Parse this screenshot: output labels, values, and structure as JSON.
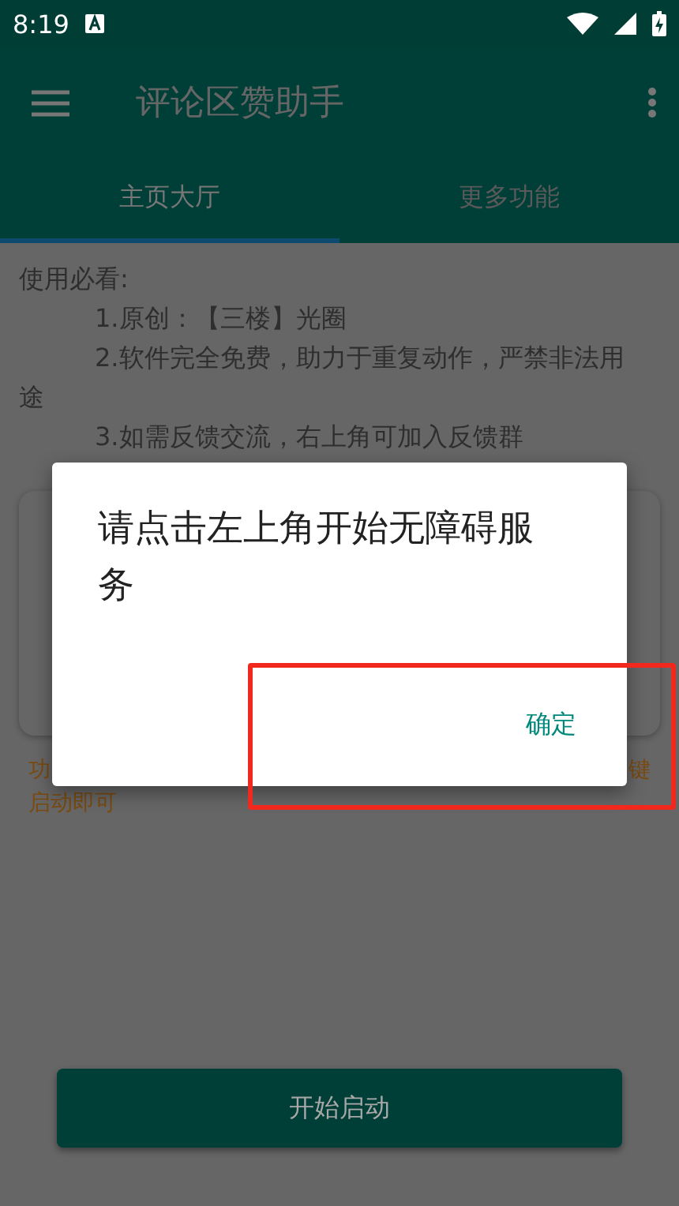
{
  "status_bar": {
    "time": "8:19"
  },
  "app_bar": {
    "title": "评论区赞助手"
  },
  "tabs": [
    {
      "label": "主页大厅",
      "selected": true
    },
    {
      "label": "更多功能",
      "selected": false
    }
  ],
  "notice": {
    "heading": "使用必看:",
    "items": [
      "1.原创：【三楼】光圈",
      "2.软件完全免费，助力于重复动作，严禁非法用途",
      "3.如需反馈交流，右上角可加入反馈群"
    ]
  },
  "hint": {
    "line_1_start": "功",
    "line_1_end": "键",
    "line_2": "启动即可"
  },
  "start_button": {
    "label": "开始启动"
  },
  "dialog": {
    "message": "请点击左上角开始无障碍服务",
    "button": "确定"
  }
}
